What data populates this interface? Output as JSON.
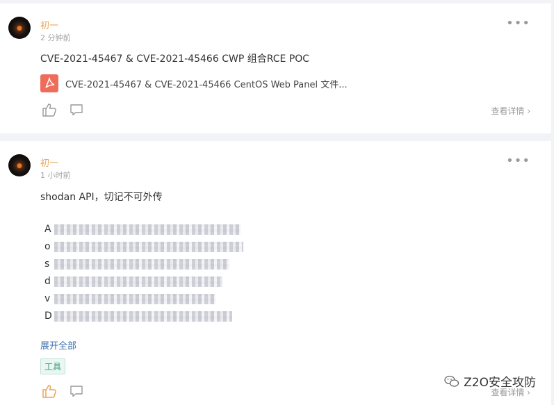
{
  "posts": [
    {
      "author": "初一",
      "time": "2 分钟前",
      "title": "CVE-2021-45467 & CVE-2021-45466 CWP 组合RCE POC",
      "file_name": "CVE-2021-45467 & CVE-2021-45466 CentOS Web Panel 文件...",
      "detail_label": "查看详情"
    },
    {
      "author": "初一",
      "time": "1 小时前",
      "title": "shodan API，切记不可外传",
      "redacted_lines": [
        "A",
        "o",
        "s",
        "d",
        "v",
        "D"
      ],
      "expand_label": "展开全部",
      "tag": "工具",
      "detail_label": "查看详情"
    }
  ],
  "watermark": "Z2O安全攻防",
  "colors": {
    "author": "#e6a35a",
    "accent_like": "#e6a35a",
    "tag": "#3a9a7a",
    "pdf": "#ef6c5a"
  }
}
